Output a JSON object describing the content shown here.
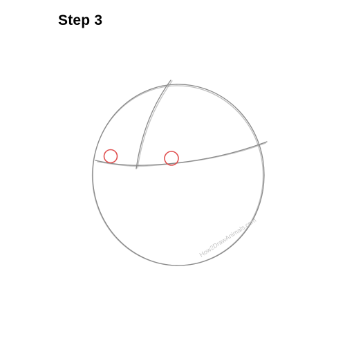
{
  "header": {
    "title": "Step 3"
  },
  "drawing": {
    "watermark": "How2DrawAnimals.com",
    "colors": {
      "guideline": "#8a8a8a",
      "eye_guide": "#e05050",
      "watermark": "#c4c4c4"
    },
    "icons": [
      "circle-head-sketch",
      "eye-guide-circle"
    ]
  }
}
